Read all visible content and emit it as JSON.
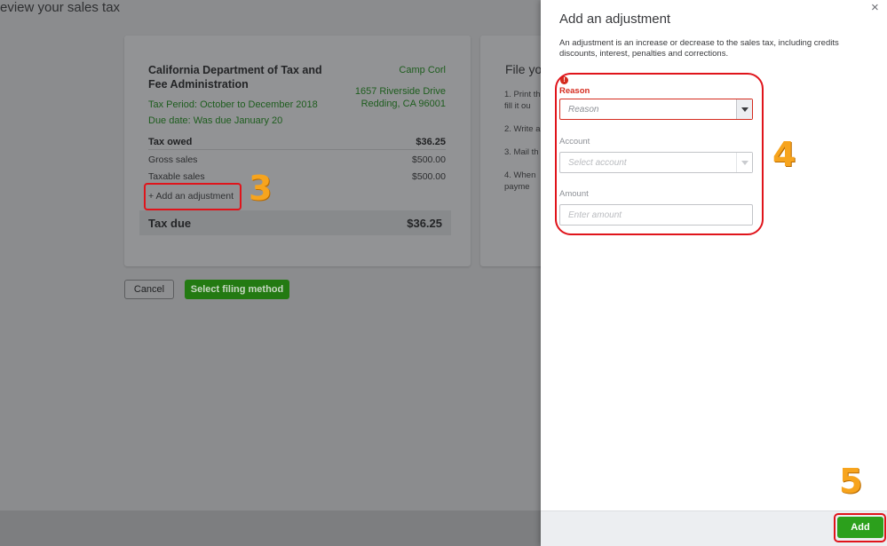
{
  "page": {
    "title": "eview your sales tax"
  },
  "filing": {
    "agency_name": "California Department of Tax and Fee Administration",
    "tax_period": "Tax Period: October to December 2018",
    "due_date": "Due date:  Was due January 20",
    "company_name": "Camp Corl",
    "address_line1": "1657 Riverside Drive",
    "address_line2": "Redding, CA 96001",
    "rows": [
      {
        "label": "Tax owed",
        "value": "$36.25"
      },
      {
        "label": "Gross sales",
        "value": "$500.00"
      },
      {
        "label": "Taxable sales",
        "value": "$500.00"
      }
    ],
    "add_adjustment_link": "+ Add an adjustment",
    "tax_due_label": "Tax due",
    "tax_due_value": "$36.25"
  },
  "file_card": {
    "title": "File yo",
    "steps": [
      "1. Print th",
      "fill it ou",
      "2. Write a",
      "3. Mail th",
      "4. When",
      "payme"
    ]
  },
  "actions": {
    "cancel_label": "Cancel",
    "select_label": "Select filing method"
  },
  "drawer": {
    "title": "Add an adjustment",
    "close_glyph": "×",
    "description": "An adjustment is an increase or decrease to the sales tax, including credits discounts, interest, penalties and corrections.",
    "reason_label": "Reason",
    "reason_placeholder": "Reason",
    "account_label": "Account",
    "account_placeholder": "Select account",
    "amount_label": "Amount",
    "amount_placeholder": "Enter amount",
    "error_glyph": "!",
    "add_label": "Add"
  },
  "annotations": {
    "step3": "3",
    "step4": "4",
    "step5": "5"
  },
  "colors": {
    "accent_green": "#2ca01c",
    "error_red": "#d52b1e",
    "annotation_orange": "#f7a41d",
    "annotation_box_red": "#e0141b"
  },
  "icons": [
    "close-icon",
    "error-icon",
    "chevron-down-icon"
  ]
}
